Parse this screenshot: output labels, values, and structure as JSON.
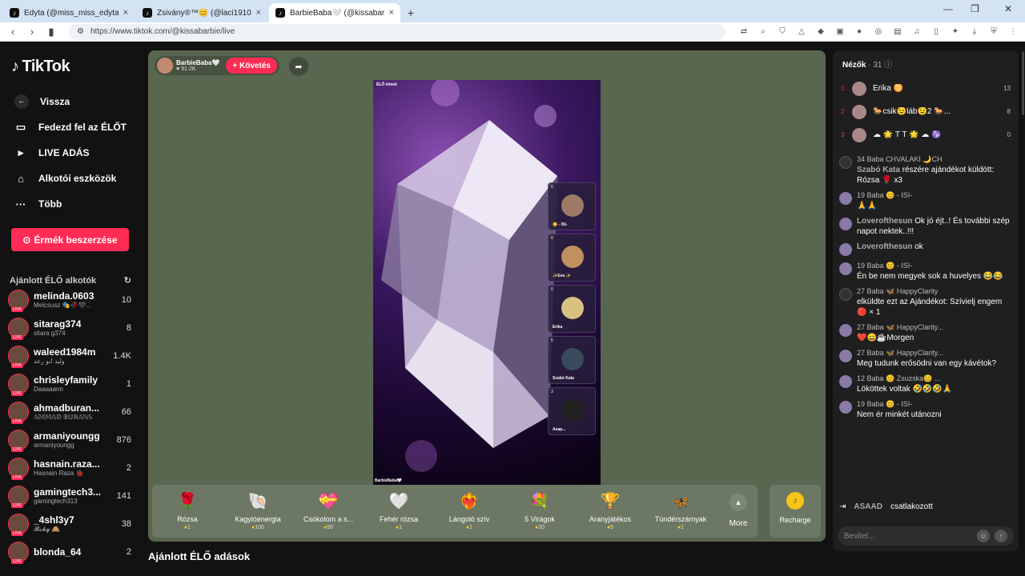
{
  "browser": {
    "tabs": [
      {
        "title": "Edyta (@miss_miss_edyta) ÉLŐ ad",
        "active": false
      },
      {
        "title": "Zsivány®™😊 (@laci1910) ÉLŐ a",
        "active": false
      },
      {
        "title": "BarbieBaba🤍 (@kissabarbie)",
        "active": true
      }
    ],
    "url": "https://www.tiktok.com/@kissabarbie/live"
  },
  "sidebar": {
    "logo": "TikTok",
    "back": "Vissza",
    "menu": [
      {
        "label": "Fedezd fel az ÉLŐT",
        "icon": "live-explore-icon"
      },
      {
        "label": "LIVE ADÁS",
        "icon": "camera-icon"
      },
      {
        "label": "Alkotói eszközök",
        "icon": "tools-icon"
      },
      {
        "label": "Több",
        "icon": "more-icon"
      }
    ],
    "coins_button": "Érmék beszerzése",
    "recommended_title": "Ajánlott ÉLŐ alkotók",
    "creators": [
      {
        "name": "melinda.0603",
        "sub": "Melcsusz 🎭🥀🖤...",
        "count": "10"
      },
      {
        "name": "sitarag374",
        "sub": "sitara g374",
        "count": "8"
      },
      {
        "name": "waleed1984m",
        "sub": "وليد ابو رعد",
        "count": "1.4K"
      },
      {
        "name": "chrisleyfamily",
        "sub": "Daaaaann",
        "count": "1"
      },
      {
        "name": "ahmadburan...",
        "sub": "𝔸𝕄𝕄𝔸𝔻 𝔹𝕌ℝ𝔸ℕ𝕊",
        "count": "66"
      },
      {
        "name": "armaniyoungg",
        "sub": "armaniyoungg",
        "count": "876"
      },
      {
        "name": "hasnain.raza...",
        "sub": "Hasnain Raza 🐞",
        "count": "2"
      },
      {
        "name": "gamingtech3...",
        "sub": "gamingtech313",
        "count": "141"
      },
      {
        "name": "_4shl3y7",
        "sub": "𝓑𝓼𝓱𝔂 🙈",
        "count": "38"
      },
      {
        "name": "blonda_64",
        "sub": "",
        "count": "2"
      }
    ]
  },
  "stage": {
    "host_name": "BarbieBaba🤍",
    "host_likes": "♥ 91.2K",
    "follow_label": "+ Követés",
    "video_label": "ÉLŐ élmek",
    "video_name": "BarbieBaba🤍",
    "guests": [
      {
        "count": "0",
        "name": "😊 - ISI-"
      },
      {
        "count": "0",
        "name": "✨Eva ✨"
      },
      {
        "count": "0",
        "name": "Erika"
      },
      {
        "count": "5",
        "name": "Szabó Kata"
      },
      {
        "count": "3",
        "name": "Asap..."
      }
    ]
  },
  "gifts": [
    {
      "name": "Rózsa",
      "price": "1",
      "icon": "🌹"
    },
    {
      "name": "Kagylóenergia",
      "price": "100",
      "icon": "🐚"
    },
    {
      "name": "Csókolom a s...",
      "price": "99",
      "icon": "💝"
    },
    {
      "name": "Fehér rózsa",
      "price": "1",
      "icon": "🤍"
    },
    {
      "name": "Lángoló szív",
      "price": "1",
      "icon": "❤️‍🔥"
    },
    {
      "name": "5 Virágok",
      "price": "20",
      "icon": "💐"
    },
    {
      "name": "Aranyjátékos",
      "price": "5",
      "icon": "🏆"
    },
    {
      "name": "Tündérszárnyak",
      "price": "1",
      "icon": "🦋"
    }
  ],
  "more_label": "More",
  "recharge_label": "Recharge",
  "recommended_live": "Ajánlott ÉLŐ adások",
  "viewers": {
    "title": "Nézők",
    "count": "· 31",
    "list": [
      {
        "rank": "1",
        "name": "Erika ♊",
        "score": "13"
      },
      {
        "rank": "2",
        "name": "🐎csik😉láb😉2 🐎...",
        "score": "8"
      },
      {
        "rank": "3",
        "name": "☁ 🌟 T T 🌟 ☁ ♑",
        "score": "0"
      }
    ]
  },
  "chat": [
    {
      "type": "gift",
      "meta": "34  Baba  CHVALAKI 🌙CH",
      "user": "Szabó Kata",
      "text": "részére ajándékot küldött: Rózsa 🌹 x3"
    },
    {
      "type": "msg",
      "meta": "19  Baba  😊 - ISI-",
      "user": "",
      "text": "🙏🙏"
    },
    {
      "type": "msg",
      "meta": "",
      "user": "Loverofthesun",
      "text": "Ok jó éjt..! És további szép napot nektek..!!!"
    },
    {
      "type": "msg",
      "meta": "",
      "user": "Loverofthesun",
      "text": "ok"
    },
    {
      "type": "msg",
      "meta": "19  Baba  😊 - ISI-",
      "user": "",
      "text": "Én be nem megyek sok a huvelyes 😂😂"
    },
    {
      "type": "gift",
      "meta": "27  Baba  🦋 HappyClarity",
      "user": "",
      "text": "elküldte ezt az Ajándékot: Szívielj engem 🔴 × 1"
    },
    {
      "type": "msg",
      "meta": "27  Baba  🦋 HappyClarity...",
      "user": "",
      "text": "❤️😄☕Morgen"
    },
    {
      "type": "msg",
      "meta": "27  Baba  🦋 HappyClarity...",
      "user": "",
      "text": "Meg tudunk erősödni van egy kávétok?"
    },
    {
      "type": "msg",
      "meta": "12  Baba  😊 Zsuzska😊 ...",
      "user": "",
      "text": "Lököttek voltak 🤣🤣🤣🙏"
    },
    {
      "type": "msg",
      "meta": "19  Baba  😊 - ISI-",
      "user": "",
      "text": "Nem ér minkét utánozni"
    }
  ],
  "join": {
    "name": "ASAAD",
    "text": "csatlakozott"
  },
  "input": {
    "placeholder": "Bevitel..."
  }
}
